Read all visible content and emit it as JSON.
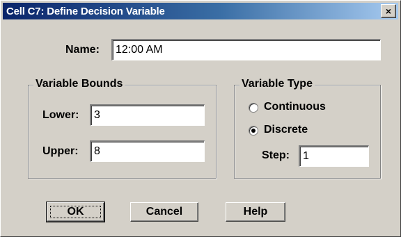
{
  "window": {
    "title": "Cell C7: Define Decision Variable",
    "close_glyph": "×"
  },
  "name": {
    "label": "Name:",
    "value": "12:00 AM"
  },
  "bounds": {
    "legend": "Variable Bounds",
    "lower_label": "Lower:",
    "lower_value": "3",
    "upper_label": "Upper:",
    "upper_value": "8"
  },
  "type": {
    "legend": "Variable Type",
    "options": [
      {
        "label": "Continuous",
        "selected": false
      },
      {
        "label": "Discrete",
        "selected": true
      }
    ],
    "step_label": "Step:",
    "step_value": "1"
  },
  "buttons": {
    "ok": "OK",
    "cancel": "Cancel",
    "help": "Help"
  },
  "colors": {
    "titlebar_start": "#0a246a",
    "titlebar_end": "#a6caf0",
    "dialog_face": "#d4d0c8"
  }
}
